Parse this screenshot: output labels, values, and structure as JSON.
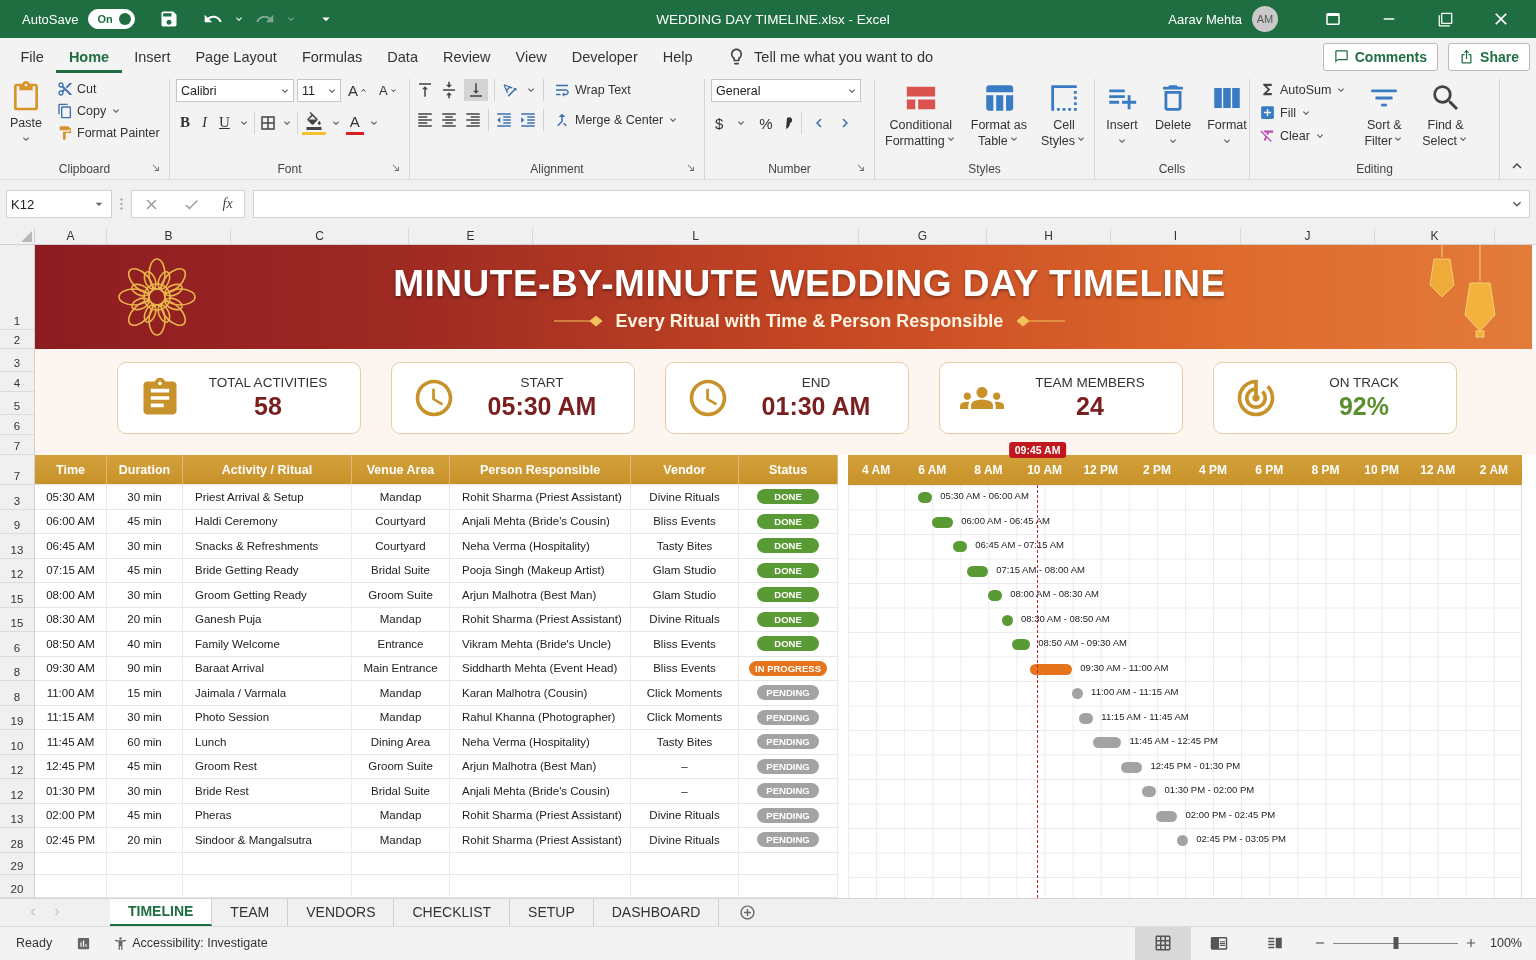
{
  "titlebar": {
    "autosave_label": "AutoSave",
    "autosave": {
      "label": "On",
      "on": true
    },
    "title": "WEDDING DAY TIMELINE.xlsx - Excel",
    "user": "Aarav Mehta",
    "avatar": "AM"
  },
  "menu": {
    "tabs": [
      {
        "label": "File",
        "selected": false
      },
      {
        "label": "Home",
        "selected": true
      },
      {
        "label": "Insert",
        "selected": false
      },
      {
        "label": "Page Layout",
        "selected": false
      },
      {
        "label": "Formulas",
        "selected": false
      },
      {
        "label": "Data",
        "selected": false
      },
      {
        "label": "Review",
        "selected": false
      },
      {
        "label": "View",
        "selected": false
      },
      {
        "label": "Developer",
        "selected": false
      },
      {
        "label": "Help",
        "selected": false
      }
    ],
    "tell_me": "Tell me what you want to do",
    "buttons": [
      "Comments",
      "Share"
    ]
  },
  "ribbon": {
    "clipboard": {
      "paste": "Paste",
      "items": [
        "Cut",
        "Copy",
        "Format Painter"
      ],
      "label": "Clipboard"
    },
    "font": {
      "name": "Calibri",
      "size": "11",
      "grow": "A",
      "shrink": "A",
      "styles": [
        "B",
        "I",
        "U"
      ],
      "color_letter": "A",
      "label": "Font"
    },
    "alignment": {
      "wrap": "Wrap Text",
      "merge": "Merge & Center",
      "label": "Alignment"
    },
    "number": {
      "format": "General",
      "currency": "$",
      "percent": "%",
      "label": "Number"
    },
    "styles": {
      "items": [
        {
          "lines": [
            "Conditional",
            "Formatting"
          ]
        },
        {
          "lines": [
            "Format as",
            "Table"
          ]
        },
        {
          "lines": [
            "Cell",
            "Styles"
          ]
        }
      ],
      "label": "Styles"
    },
    "cells": {
      "items": [
        "Insert",
        "Delete",
        "Format"
      ],
      "label": "Cells"
    },
    "editing": {
      "small": [
        "AutoSum",
        "Fill",
        "Clear"
      ],
      "large": [
        {
          "lines": [
            "Sort &",
            "Filter"
          ]
        },
        {
          "lines": [
            "Find &",
            "Select"
          ]
        }
      ],
      "label": "Editing"
    }
  },
  "formula_bar": {
    "name_box": "K12",
    "fx": "fx"
  },
  "columns": [
    "A",
    "B",
    "C",
    "E",
    "L",
    "G",
    "H",
    "I",
    "J",
    "K"
  ],
  "banner": {
    "title": "MINUTE-BY-MINUTE WEDDING DAY TIMELINE",
    "subtitle": "Every Ritual with Time & Person Responsible",
    "row_numbers": [
      "1",
      "2"
    ]
  },
  "kpis": {
    "row_numbers": [
      "3",
      "4",
      "5",
      "6",
      "7"
    ],
    "cards": [
      {
        "label": "TOTAL ACTIVITIES",
        "value": "58",
        "color": "#7a1f1f"
      },
      {
        "label": "START",
        "value": "05:30 AM",
        "color": "#7a1f1f"
      },
      {
        "label": "END",
        "value": "01:30 AM",
        "color": "#7a1f1f"
      },
      {
        "label": "TEAM MEMBERS",
        "value": "24",
        "color": "#7a1f1f"
      },
      {
        "label": "ON TRACK",
        "value": "92%",
        "color": "#5b8f2e"
      }
    ]
  },
  "table": {
    "row_number": "7",
    "columns": [
      "Time",
      "Duration",
      "Activity / Ritual",
      "Venue Area",
      "Person Responsible",
      "Vendor",
      "Status"
    ],
    "rows": [
      {
        "row_number": "3",
        "time": "05:30 AM",
        "duration": "30 min",
        "activity": "Priest Arrival & Setup",
        "venue": "Mandap",
        "person": "Rohit Sharma (Priest Assistant)",
        "vendor": "Divine Rituals",
        "status": {
          "label": "DONE",
          "kind": "done"
        }
      },
      {
        "row_number": "9",
        "time": "06:00 AM",
        "duration": "45 min",
        "activity": "Haldi Ceremony",
        "venue": "Courtyard",
        "person": "Anjali Mehta (Bride's Cousin)",
        "vendor": "Bliss Events",
        "status": {
          "label": "DONE",
          "kind": "done"
        }
      },
      {
        "row_number": "13",
        "time": "06:45 AM",
        "duration": "30 min",
        "activity": "Snacks & Refreshments",
        "venue": "Courtyard",
        "person": "Neha Verma (Hospitality)",
        "vendor": "Tasty Bites",
        "status": {
          "label": "DONE",
          "kind": "done"
        }
      },
      {
        "row_number": "12",
        "time": "07:15 AM",
        "duration": "45 min",
        "activity": "Bride Getting Ready",
        "venue": "Bridal Suite",
        "person": "Pooja Singh (Makeup Artist)",
        "vendor": "Glam Studio",
        "status": {
          "label": "DONE",
          "kind": "done"
        }
      },
      {
        "row_number": "15",
        "time": "08:00 AM",
        "duration": "30 min",
        "activity": "Groom Getting Ready",
        "venue": "Groom Suite",
        "person": "Arjun Malhotra (Best Man)",
        "vendor": "Glam Studio",
        "status": {
          "label": "DONE",
          "kind": "done"
        }
      },
      {
        "row_number": "15",
        "time": "08:30 AM",
        "duration": "20 min",
        "activity": "Ganesh Puja",
        "venue": "Mandap",
        "person": "Rohit Sharma (Priest Assistant)",
        "vendor": "Divine Rituals",
        "status": {
          "label": "DONE",
          "kind": "done"
        }
      },
      {
        "row_number": "6",
        "time": "08:50 AM",
        "duration": "40 min",
        "activity": "Family Welcome",
        "venue": "Entrance",
        "person": "Vikram Mehta (Bride's Uncle)",
        "vendor": "Bliss Events",
        "status": {
          "label": "DONE",
          "kind": "done"
        }
      },
      {
        "row_number": "8",
        "time": "09:30 AM",
        "duration": "90 min",
        "activity": "Baraat Arrival",
        "venue": "Main Entrance",
        "person": "Siddharth Mehta (Event Head)",
        "vendor": "Bliss Events",
        "status": {
          "label": "IN PROGRESS",
          "kind": "in_progress"
        }
      },
      {
        "row_number": "8",
        "time": "11:00 AM",
        "duration": "15 min",
        "activity": "Jaimala / Varmala",
        "venue": "Mandap",
        "person": "Karan Malhotra (Cousin)",
        "vendor": "Click Moments",
        "status": {
          "label": "PENDING",
          "kind": "pending"
        }
      },
      {
        "row_number": "19",
        "time": "11:15 AM",
        "duration": "30 min",
        "activity": "Photo Session",
        "venue": "Mandap",
        "person": "Rahul Khanna (Photographer)",
        "vendor": "Click Moments",
        "status": {
          "label": "PENDING",
          "kind": "pending"
        }
      },
      {
        "row_number": "10",
        "time": "11:45 AM",
        "duration": "60 min",
        "activity": "Lunch",
        "venue": "Dining Area",
        "person": "Neha Verma (Hospitality)",
        "vendor": "Tasty Bites",
        "status": {
          "label": "PENDING",
          "kind": "pending"
        }
      },
      {
        "row_number": "12",
        "time": "12:45 PM",
        "duration": "45 min",
        "activity": "Groom Rest",
        "venue": "Groom Suite",
        "person": "Arjun Malhotra (Best Man)",
        "vendor": "–",
        "status": {
          "label": "PENDING",
          "kind": "pending"
        }
      },
      {
        "row_number": "12",
        "time": "01:30 PM",
        "duration": "30 min",
        "activity": "Bride Rest",
        "venue": "Bridal Suite",
        "person": "Anjali Mehta (Bride's Cousin)",
        "vendor": "–",
        "status": {
          "label": "PENDING",
          "kind": "pending"
        }
      },
      {
        "row_number": "13",
        "time": "02:00 PM",
        "duration": "45 min",
        "activity": "Pheras",
        "venue": "Mandap",
        "person": "Rohit Sharma (Priest Assistant)",
        "vendor": "Divine Rituals",
        "status": {
          "label": "PENDING",
          "kind": "pending"
        }
      },
      {
        "row_number": "28",
        "time": "02:45 PM",
        "duration": "20 min",
        "activity": "Sindoor & Mangalsutra",
        "venue": "Mandap",
        "person": "Rohit Sharma (Priest Assistant)",
        "vendor": "Divine Rituals",
        "status": {
          "label": "PENDING",
          "kind": "pending"
        }
      }
    ]
  },
  "extra_rows": [
    "29",
    "20"
  ],
  "gantt": {
    "ticks": [
      "4 AM",
      "6 AM",
      "8 AM",
      "10 AM",
      "12 PM",
      "2 PM",
      "4 PM",
      "6 PM",
      "8 PM",
      "10 PM",
      "12 AM",
      "2 AM"
    ],
    "now": "09:45 AM",
    "bars": [
      "05:30 AM - 06:00 AM",
      "06:00 AM - 06:45 AM",
      "06:45 AM - 07:15 AM",
      "07:15 AM - 08:00 AM",
      "08:00 AM - 08:30 AM",
      "08:30 AM - 08:50 AM",
      "08:50 AM - 09:30 AM",
      "09:30 AM - 11:00 AM",
      "11:00 AM - 11:15 AM",
      "11:15 AM - 11:45 AM",
      "11:45 AM - 12:45 PM",
      "12:45 PM - 01:30 PM",
      "01:30 PM - 02:00 PM",
      "02:00 PM - 02:45 PM",
      "02:45 PM - 03:05 PM"
    ]
  },
  "sheet_tabs": [
    {
      "label": "TIMELINE",
      "selected": true
    },
    {
      "label": "TEAM",
      "selected": false
    },
    {
      "label": "VENDORS",
      "selected": false
    },
    {
      "label": "CHECKLIST",
      "selected": false
    },
    {
      "label": "SETUP",
      "selected": false
    },
    {
      "label": "DASHBOARD",
      "selected": false
    }
  ],
  "status_bar": {
    "ready": "Ready",
    "accessibility": "Accessibility: Investigate",
    "views": [
      {
        "selected": true
      },
      {
        "selected": false
      },
      {
        "selected": false
      }
    ],
    "zoom": {
      "level": 0.5,
      "label": "100%"
    }
  }
}
